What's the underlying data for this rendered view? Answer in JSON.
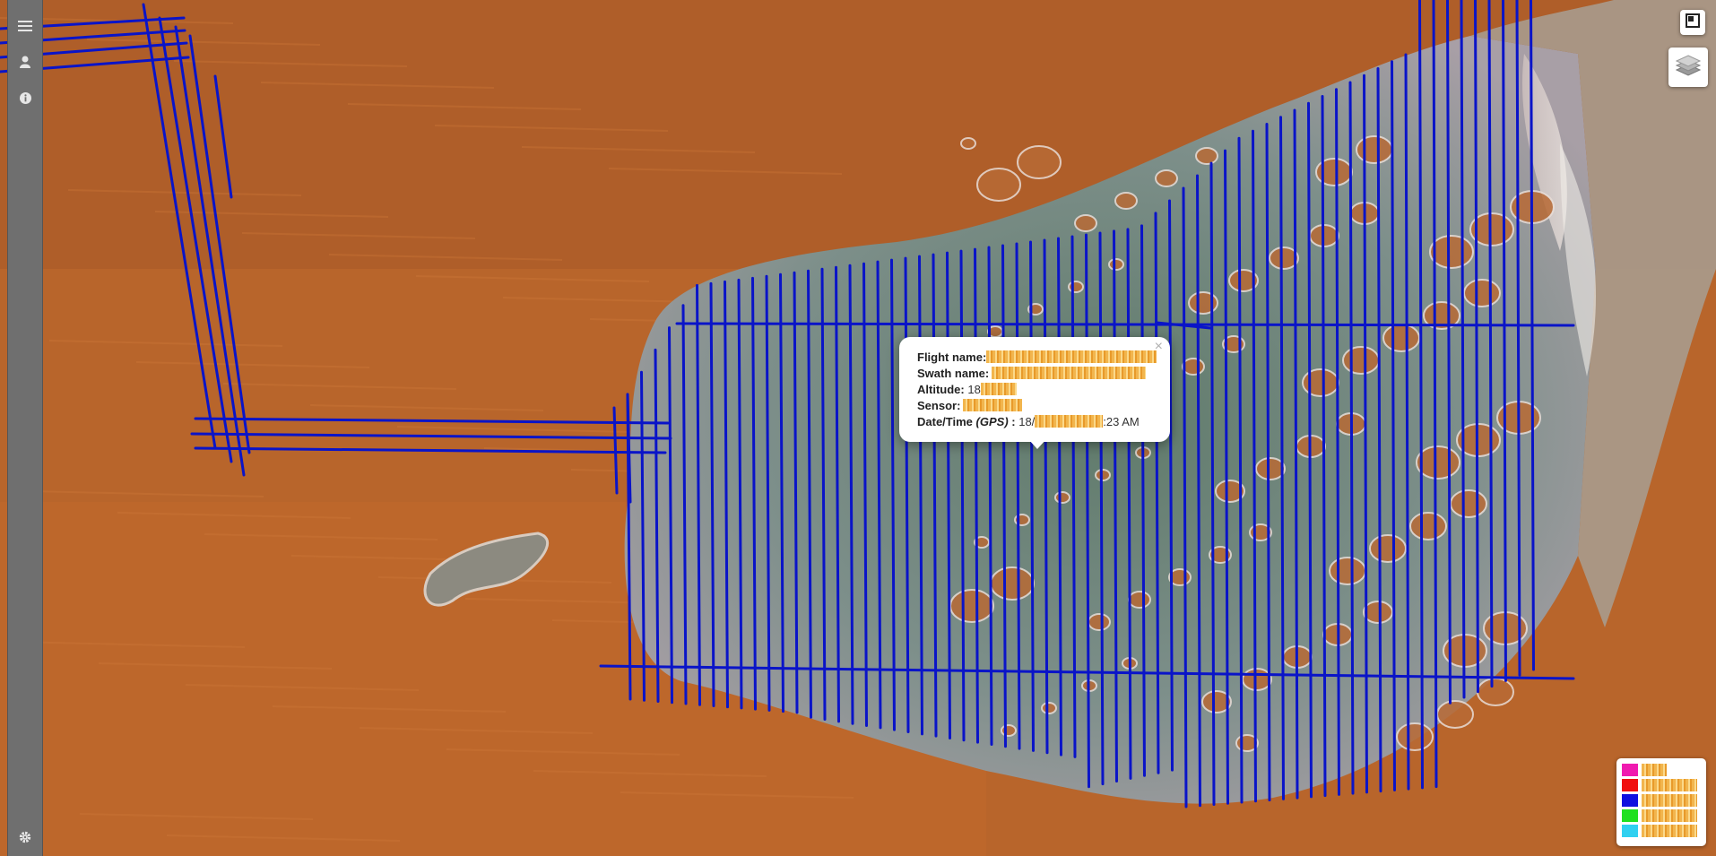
{
  "map": {
    "basemap": "satellite-imagery",
    "swath_color": "#0a14c8"
  },
  "sidebar": {
    "items": [
      {
        "icon": "menu-icon"
      },
      {
        "icon": "user-icon"
      },
      {
        "icon": "info-icon"
      },
      {
        "icon": "gear-icon"
      }
    ]
  },
  "controls": {
    "fullscreen_icon": "fullscreen-icon",
    "layers_icon": "layers-icon"
  },
  "popup": {
    "close_glyph": "×",
    "rows": [
      {
        "label": "Flight name:",
        "value": ""
      },
      {
        "label": "Swath name:",
        "value": ""
      },
      {
        "label": "Altitude:",
        "value": "18"
      },
      {
        "label": "Sensor:",
        "value": ""
      },
      {
        "label": "Date/Time",
        "label_em": "(GPS)",
        "label_tail": " : ",
        "value": "18/",
        "value_tail": ":23 AM"
      }
    ]
  },
  "legend": {
    "items": [
      {
        "color": "#f01ab0"
      },
      {
        "color": "#f01010"
      },
      {
        "color": "#1010e0"
      },
      {
        "color": "#20e020"
      },
      {
        "color": "#30d0f0"
      }
    ]
  }
}
